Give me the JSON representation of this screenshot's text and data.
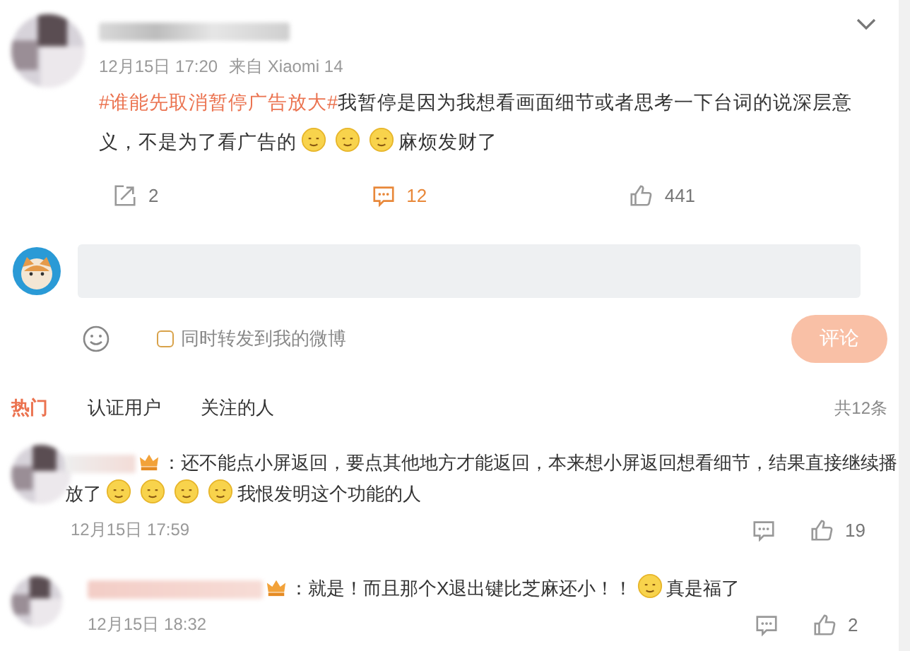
{
  "post": {
    "time": "12月15日 17:20",
    "source": "来自 Xiaomi 14",
    "lines": [
      [
        {
          "kind": "hashtag",
          "text": "#谁能先取消暂停广告放大#"
        },
        {
          "kind": "text",
          "text": "我暂停是因为我想看画面细节或者思考一下台词的说深层意"
        }
      ],
      [
        {
          "kind": "text",
          "text": "义，不是为了看广告的"
        },
        {
          "kind": "emoji"
        },
        {
          "kind": "emoji"
        },
        {
          "kind": "emoji"
        },
        {
          "kind": "text",
          "text": "麻烦发财了"
        }
      ]
    ],
    "actions": [
      {
        "kind": "repost",
        "count": "2"
      },
      {
        "kind": "comment",
        "count": "12"
      },
      {
        "kind": "like",
        "count": "441"
      }
    ]
  },
  "compose": {
    "checkbox": {
      "label": "同时转发到我的微博",
      "checked": false
    },
    "button": {
      "label": "评论",
      "disabled": true
    }
  },
  "tabs": [
    {
      "label": "热门",
      "selected": true
    },
    {
      "label": "认证用户",
      "selected": false
    },
    {
      "label": "关注的人",
      "selected": false
    }
  ],
  "total": "共12条",
  "comments": [
    {
      "lines": [
        [
          {
            "kind": "name"
          },
          {
            "kind": "text",
            "text": "：还不能点小屏返回，要点其他地方才能返回，本来想小屏返回想看细节，结果直接继续播"
          }
        ],
        [
          {
            "kind": "text",
            "text": "放了"
          },
          {
            "kind": "emoji"
          },
          {
            "kind": "emoji"
          },
          {
            "kind": "emoji"
          },
          {
            "kind": "emoji"
          },
          {
            "kind": "text",
            "text": "我恨发明这个功能的人"
          }
        ]
      ],
      "time": "12月15日 17:59",
      "likes": "19"
    },
    {
      "lines": [
        [
          {
            "kind": "name"
          },
          {
            "kind": "text",
            "text": "：就是！而且那个X退出键比芝麻还小！！"
          },
          {
            "kind": "emoji"
          },
          {
            "kind": "text",
            "text": "真是福了"
          }
        ]
      ],
      "time": "12月15日 18:32",
      "likes": "2"
    }
  ]
}
